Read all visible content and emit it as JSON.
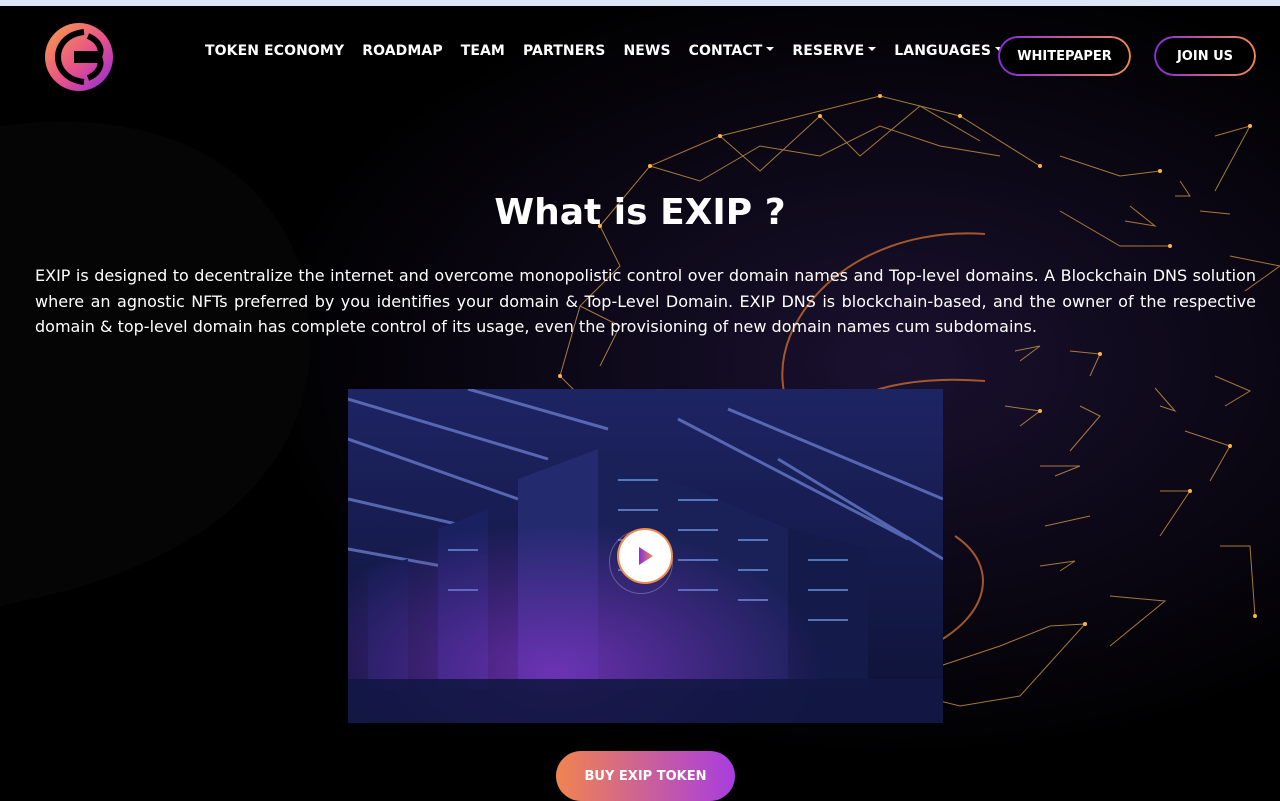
{
  "header": {
    "logo": "exip-logo",
    "nav": [
      {
        "label": "TOKEN ECONOMY",
        "dropdown": false
      },
      {
        "label": "ROADMAP",
        "dropdown": false
      },
      {
        "label": "TEAM",
        "dropdown": false
      },
      {
        "label": "PARTNERS",
        "dropdown": false
      },
      {
        "label": "NEWS",
        "dropdown": false
      },
      {
        "label": "CONTACT",
        "dropdown": true
      },
      {
        "label": "RESERVE",
        "dropdown": true
      },
      {
        "label": "LANGUAGES",
        "dropdown": true
      }
    ],
    "whitepaper_label": "WHITEPAPER",
    "join_label": "JOIN US"
  },
  "main": {
    "title": "What is EXIP ?",
    "description": "EXIP is designed to decentralize the internet and overcome monopolistic control over domain names and Top-level domains. A Blockchain DNS solution where an agnostic NFTs preferred by you identifies your domain & Top-Level Domain. EXIP DNS is blockchain-based, and the owner of the respective domain & top-level domain has complete control of its usage, even the provisioning of new domain names cum subdomains.",
    "video_icon": "play-icon",
    "buy_label": "BUY EXIP TOKEN"
  },
  "colors": {
    "accent_orange": "#f08a4b",
    "accent_purple": "#8a2be2",
    "background": "#000000"
  }
}
